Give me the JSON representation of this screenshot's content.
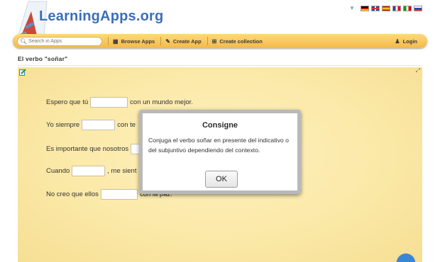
{
  "header": {
    "logo_text": "LearningApps.org",
    "languages": [
      "de",
      "en",
      "es",
      "fr",
      "it",
      "ru"
    ]
  },
  "navbar": {
    "search_placeholder": "Search in Apps",
    "browse_label": "Browse Apps",
    "create_app_label": "Create App",
    "create_collection_label": "Create collection",
    "login_label": "Login"
  },
  "page": {
    "title": "El verbo \"soñar\""
  },
  "exercise": {
    "sentences": [
      {
        "before": "Espero que tú",
        "after": "con un mundo mejor."
      },
      {
        "before": "Yo siempre",
        "after": "con te"
      },
      {
        "before": "Es importante que nosotros",
        "after": ""
      },
      {
        "before": "Cuando",
        "after": ", me sient"
      },
      {
        "before": "No creo que ellos",
        "after": "con la paz."
      }
    ]
  },
  "modal": {
    "title": "Consigne",
    "text": "Conjuga el verbo soñar en presente del indicativo o del subjuntivo dependiendo del contexto.",
    "ok_label": "OK"
  },
  "colors": {
    "accent_blue": "#3b6fb6",
    "navbar_gold": "#f3b94a",
    "paper": "#fbe9a8"
  },
  "icons": {
    "search": "search-icon",
    "browse": "grid-icon",
    "create": "pencil-icon",
    "collection": "collection-icon",
    "login": "user-icon",
    "edit": "edit-icon",
    "fullscreen": "fullscreen-icon",
    "help": "help-icon"
  }
}
